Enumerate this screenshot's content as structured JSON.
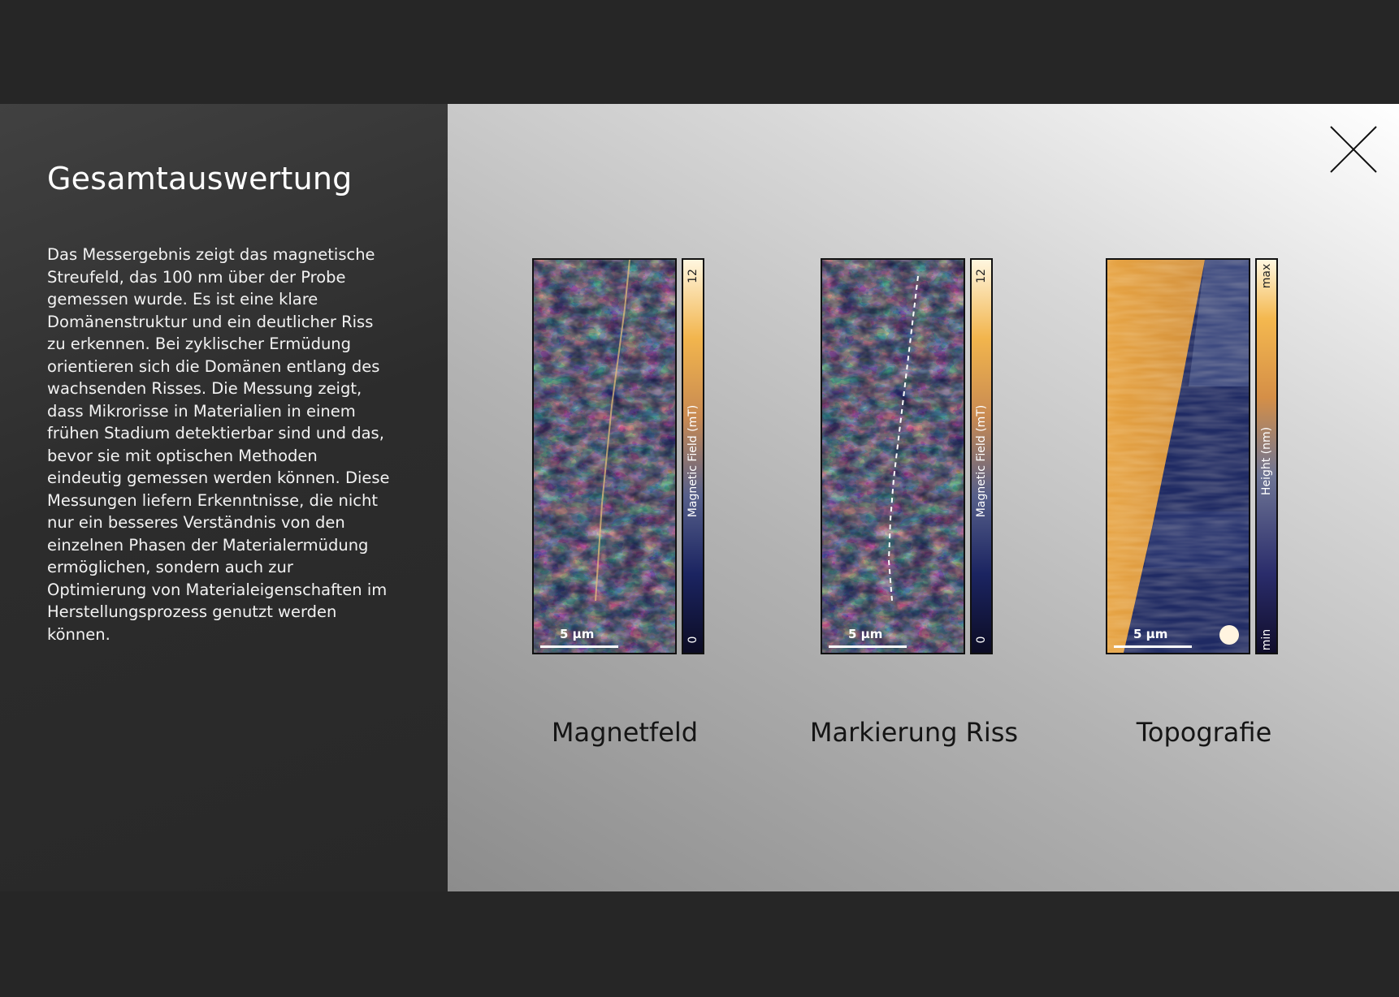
{
  "panel": {
    "title": "Gesamtauswertung",
    "text": "Das Messergebnis zeigt das magnetische Streufeld, das 100 nm über der Probe gemessen wurde. Es ist eine klare Domänenstruktur und ein deutlicher Riss zu erkennen. Bei zyklischer Ermüdung orientieren sich die Domänen entlang des wachsenden Risses. Die Messung zeigt, dass Mikrorisse in Materialien in einem frühen Stadium detektierbar sind und das, bevor sie mit optischen Methoden eindeutig gemessen werden können. Diese Messungen liefern Erkenntnisse, die nicht nur ein besseres Verständnis von den einzelnen Phasen der Materialermüdung ermöglichen, sondern auch zur Optimierung von Materialeigenschaften im Herstellungsprozess genutzt werden können."
  },
  "close_icon": "close-x-icon",
  "figures": [
    {
      "caption": "Magnetfeld",
      "scale_label": "5 µm",
      "colorbar": {
        "label": "Magnetic Field (mT)",
        "max": "12",
        "min": "0"
      }
    },
    {
      "caption": "Markierung Riss",
      "scale_label": "5 µm",
      "colorbar": {
        "label": "Magnetic Field (mT)",
        "max": "12",
        "min": "0"
      }
    },
    {
      "caption": "Topografie",
      "scale_label": "5 µm",
      "colorbar": {
        "label": "Height (nm)",
        "max": "max",
        "min": "min"
      }
    }
  ],
  "colors": {
    "page_background": "#262626",
    "side_panel": "#333333",
    "colormap_low": "#0c0c24",
    "colormap_mid": "#1b2461",
    "colormap_high": "#f2b54d"
  }
}
